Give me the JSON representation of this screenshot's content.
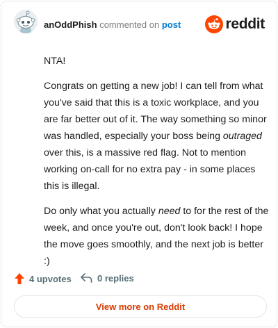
{
  "header": {
    "author": "anOddPhish",
    "commented_text": "commented on",
    "post_link": "post",
    "brand": "reddit"
  },
  "comment": {
    "p1": "NTA!",
    "p2_a": "Congrats on getting a new job! I can tell from what you've said that this is a toxic workplace, and you are far better out of it. The way something so minor was handled, especially your boss being ",
    "p2_em": "outraged",
    "p2_b": " over this, is a massive red flag. Not to mention working on-call for no extra pay - in some places this is illegal.",
    "p3_a": "Do only what you actually ",
    "p3_em": "need",
    "p3_b": " to for the rest of the week, and once you're out, don't look back! I hope the move goes smoothly, and the next job is better :)"
  },
  "footer": {
    "upvotes": "4 upvotes",
    "replies": "0 replies",
    "view_more": "View more on Reddit"
  },
  "colors": {
    "reddit_orange": "#ff4500",
    "link_blue": "#0079d3",
    "view_more_text": "#d93a00"
  },
  "icons": {
    "upvote": "upvote-arrow-icon",
    "reply": "reply-arrow-icon",
    "brand": "reddit-snoo-icon"
  }
}
